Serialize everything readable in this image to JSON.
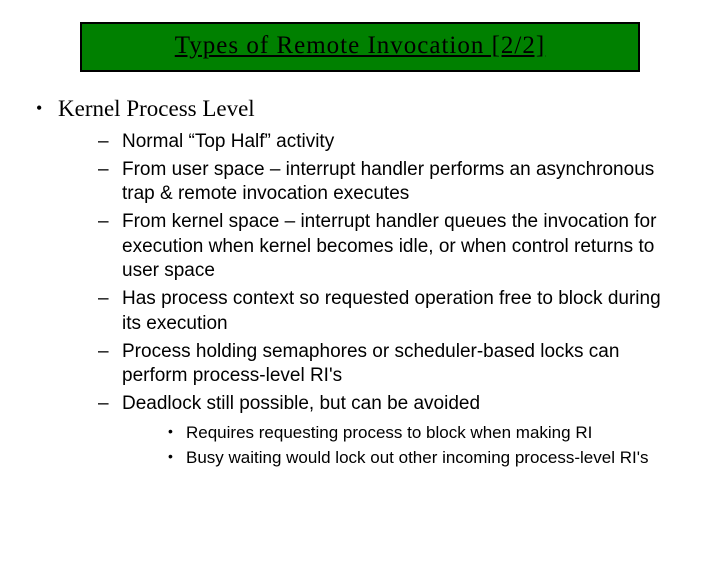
{
  "slide": {
    "title": "Types of Remote Invocation  [2/2]",
    "heading": "Kernel Process Level",
    "bullets": [
      "Normal “Top Half” activity",
      "From user space – interrupt handler performs an asynchronous trap & remote invocation executes",
      "From kernel space – interrupt handler queues the invocation for execution when kernel becomes idle, or when control returns to user space",
      "Has process context so requested operation free to block during its execution",
      "Process holding semaphores or scheduler-based locks can perform process-level RI's",
      "Deadlock still possible, but can be avoided"
    ],
    "sub_bullets": [
      "Requires requesting process to block when making RI",
      "Busy waiting would lock out other incoming process-level RI's"
    ]
  }
}
